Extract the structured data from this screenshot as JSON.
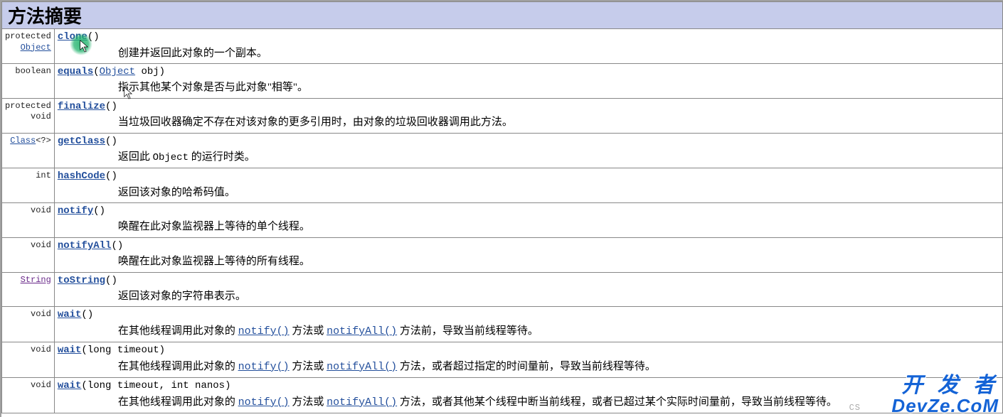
{
  "title": "方法摘要",
  "rows": [
    {
      "mod_plain": "protected",
      "mod_link": "Object",
      "method": "clone",
      "paren_open": "(",
      "params_plain": "",
      "paren_close": ")",
      "desc_plain_1": "创建并返回此对象的一个副本。"
    },
    {
      "mod_plain": "boolean",
      "method": "equals",
      "paren_open": "(",
      "param_type_link": "Object",
      "param_name": " obj",
      "paren_close": ")",
      "desc_plain_1": "指示其他某个对象是否与此对象\"相等\"。"
    },
    {
      "mod_plain": "protected\n void",
      "method": "finalize",
      "paren_open": "(",
      "paren_close": ")",
      "desc_plain_1": "当垃圾回收器确定不存在对该对象的更多引用时，由对象的垃圾回收器调用此方法。"
    },
    {
      "mod_link": "Class",
      "mod_suffix": "<?>",
      "method": "getClass",
      "paren_open": "(",
      "paren_close": ")",
      "desc_plain_1": "返回此 ",
      "desc_mono_1": "Object",
      "desc_plain_2": " 的运行时类。"
    },
    {
      "mod_plain": "int",
      "method": "hashCode",
      "paren_open": "(",
      "paren_close": ")",
      "desc_plain_1": "返回该对象的哈希码值。"
    },
    {
      "mod_plain": "void",
      "method": "notify",
      "paren_open": "(",
      "paren_close": ")",
      "desc_plain_1": "唤醒在此对象监视器上等待的单个线程。"
    },
    {
      "mod_plain": "void",
      "method": "notifyAll",
      "paren_open": "(",
      "paren_close": ")",
      "desc_plain_1": "唤醒在此对象监视器上等待的所有线程。"
    },
    {
      "mod_link": "String",
      "mod_link_visited": true,
      "method": "toString",
      "paren_open": "(",
      "paren_close": ")",
      "desc_plain_1": "返回该对象的字符串表示。"
    },
    {
      "mod_plain": "void",
      "method": "wait",
      "paren_open": "(",
      "paren_close": ")",
      "desc_plain_1": "在其他线程调用此对象的 ",
      "desc_link_1": "notify()",
      "desc_plain_2": " 方法或 ",
      "desc_link_2": "notifyAll()",
      "desc_plain_3": " 方法前，导致当前线程等待。"
    },
    {
      "mod_plain": "void",
      "method": "wait",
      "paren_open": "(",
      "params_plain": "long timeout",
      "paren_close": ")",
      "desc_plain_1": "在其他线程调用此对象的 ",
      "desc_link_1": "notify()",
      "desc_plain_2": " 方法或 ",
      "desc_link_2": "notifyAll()",
      "desc_plain_3": " 方法，或者超过指定的时间量前，导致当前线程等待。"
    },
    {
      "mod_plain": "void",
      "method": "wait",
      "paren_open": "(",
      "params_plain": "long timeout, int nanos",
      "paren_close": ")",
      "desc_plain_1": "在其他线程调用此对象的 ",
      "desc_link_1": "notify()",
      "desc_plain_2": " 方法或 ",
      "desc_link_2": "notifyAll()",
      "desc_plain_3": " 方法，或者其他某个线程中断当前线程，或者已超过某个实际时间量前，导致当前线程等待。"
    }
  ],
  "watermark": {
    "line1": "开 发 者",
    "line2": "DevZe.CoM"
  },
  "csdn_stub": "CS"
}
